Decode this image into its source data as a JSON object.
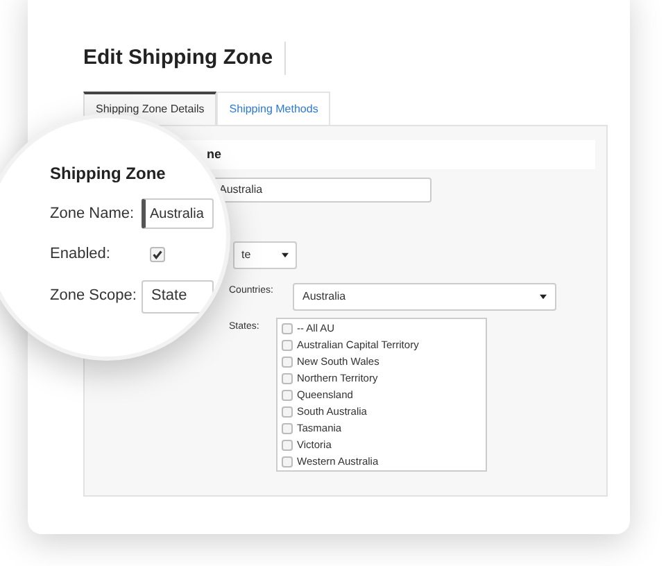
{
  "title": "Edit Shipping Zone",
  "tabs": [
    {
      "label": "Shipping Zone Details",
      "selected": true
    },
    {
      "label": "Shipping Methods",
      "selected": false
    }
  ],
  "section": {
    "heading": "ne"
  },
  "zone_name": {
    "value": "Australia"
  },
  "scope": {
    "value": "te"
  },
  "countries": {
    "label": "Countries:",
    "value": "Australia"
  },
  "states": {
    "label": "States:",
    "options": [
      {
        "label": "-- All AU",
        "checked": false
      },
      {
        "label": "Australian Capital Territory",
        "checked": false
      },
      {
        "label": "New South Wales",
        "checked": false
      },
      {
        "label": "Northern Territory",
        "checked": false
      },
      {
        "label": "Queensland",
        "checked": false
      },
      {
        "label": "South Australia",
        "checked": false
      },
      {
        "label": "Tasmania",
        "checked": false
      },
      {
        "label": "Victoria",
        "checked": false
      },
      {
        "label": "Western Australia",
        "checked": false
      }
    ]
  },
  "magnifier": {
    "heading": "Shipping Zone",
    "fields": [
      {
        "kind": "text",
        "label": "Zone Name:",
        "value": "Australia"
      },
      {
        "kind": "checkbox",
        "label": "Enabled:",
        "checked": true
      },
      {
        "kind": "select",
        "label": "Zone Scope:",
        "value": "State"
      }
    ]
  }
}
